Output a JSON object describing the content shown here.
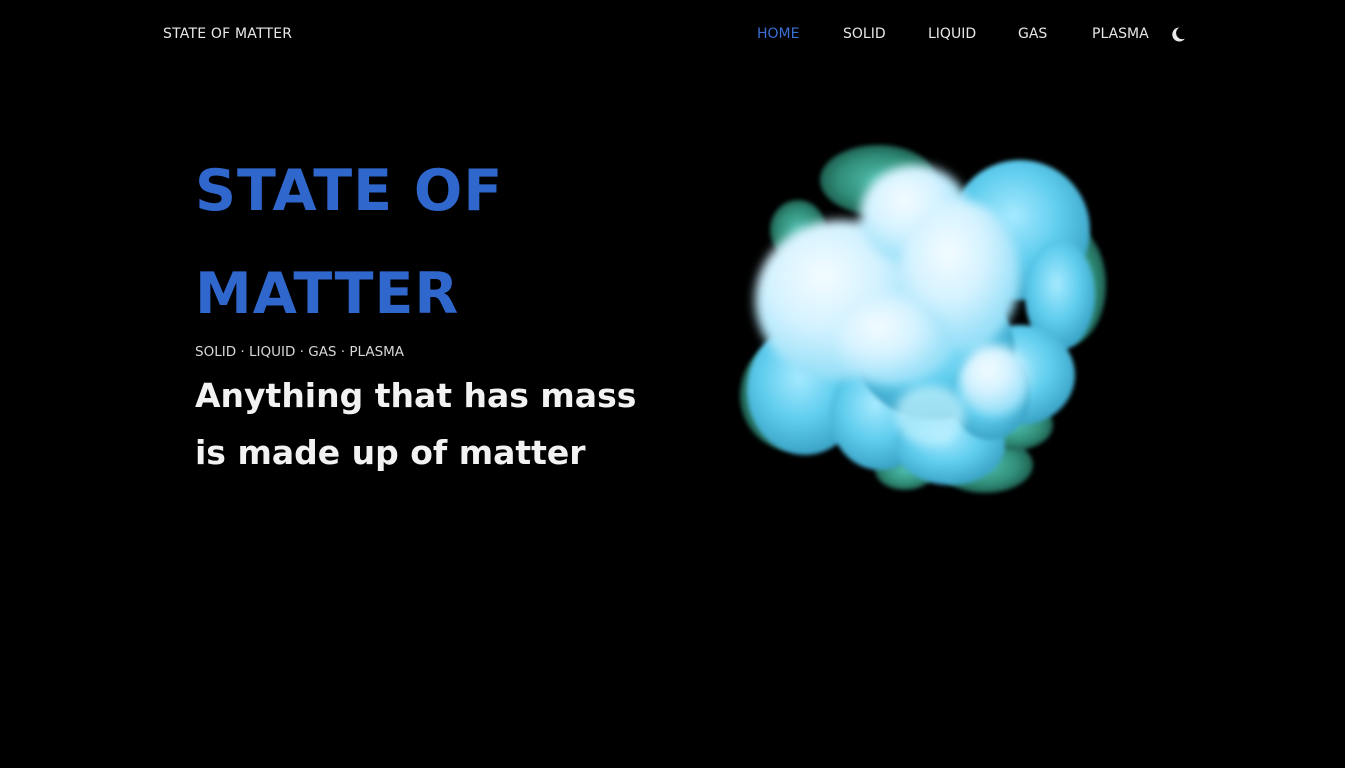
{
  "brand": "STATE OF MATTER",
  "nav": {
    "items": [
      "HOME",
      "SOLID",
      "LIQUID",
      "GAS",
      "PLASMA"
    ],
    "active": "HOME",
    "theme_toggle_icon": "moon-icon"
  },
  "hero": {
    "title_line1": "STATE OF",
    "title_line2": "MATTER",
    "subtitle": "SOLID · LIQUID · GAS · PLASMA",
    "desc_line1": "Anything that has mass",
    "desc_line2": "is made up of matter"
  },
  "colors": {
    "background": "#000000",
    "accent": "#2f67cd",
    "nav_active": "#3c6fd4",
    "text": "#f2f2f2",
    "blob_core": "#dff6ff",
    "blob_mid": "#64d0ef",
    "blob_edge": "#2e8a74"
  }
}
